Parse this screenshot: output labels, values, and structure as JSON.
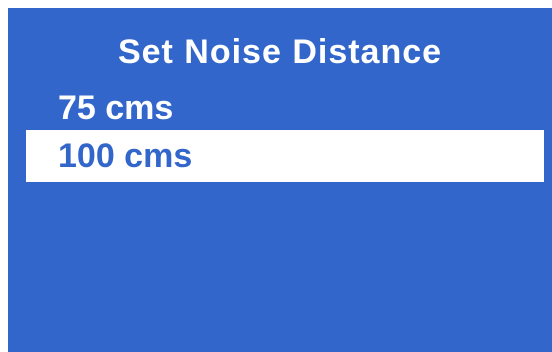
{
  "screen": {
    "title": "Set Noise Distance",
    "background_color": "#3266cb",
    "highlight_color": "#ffffff"
  },
  "menu": {
    "items": [
      {
        "label": "75 cms",
        "selected": false
      },
      {
        "label": "100 cms",
        "selected": true
      }
    ]
  }
}
